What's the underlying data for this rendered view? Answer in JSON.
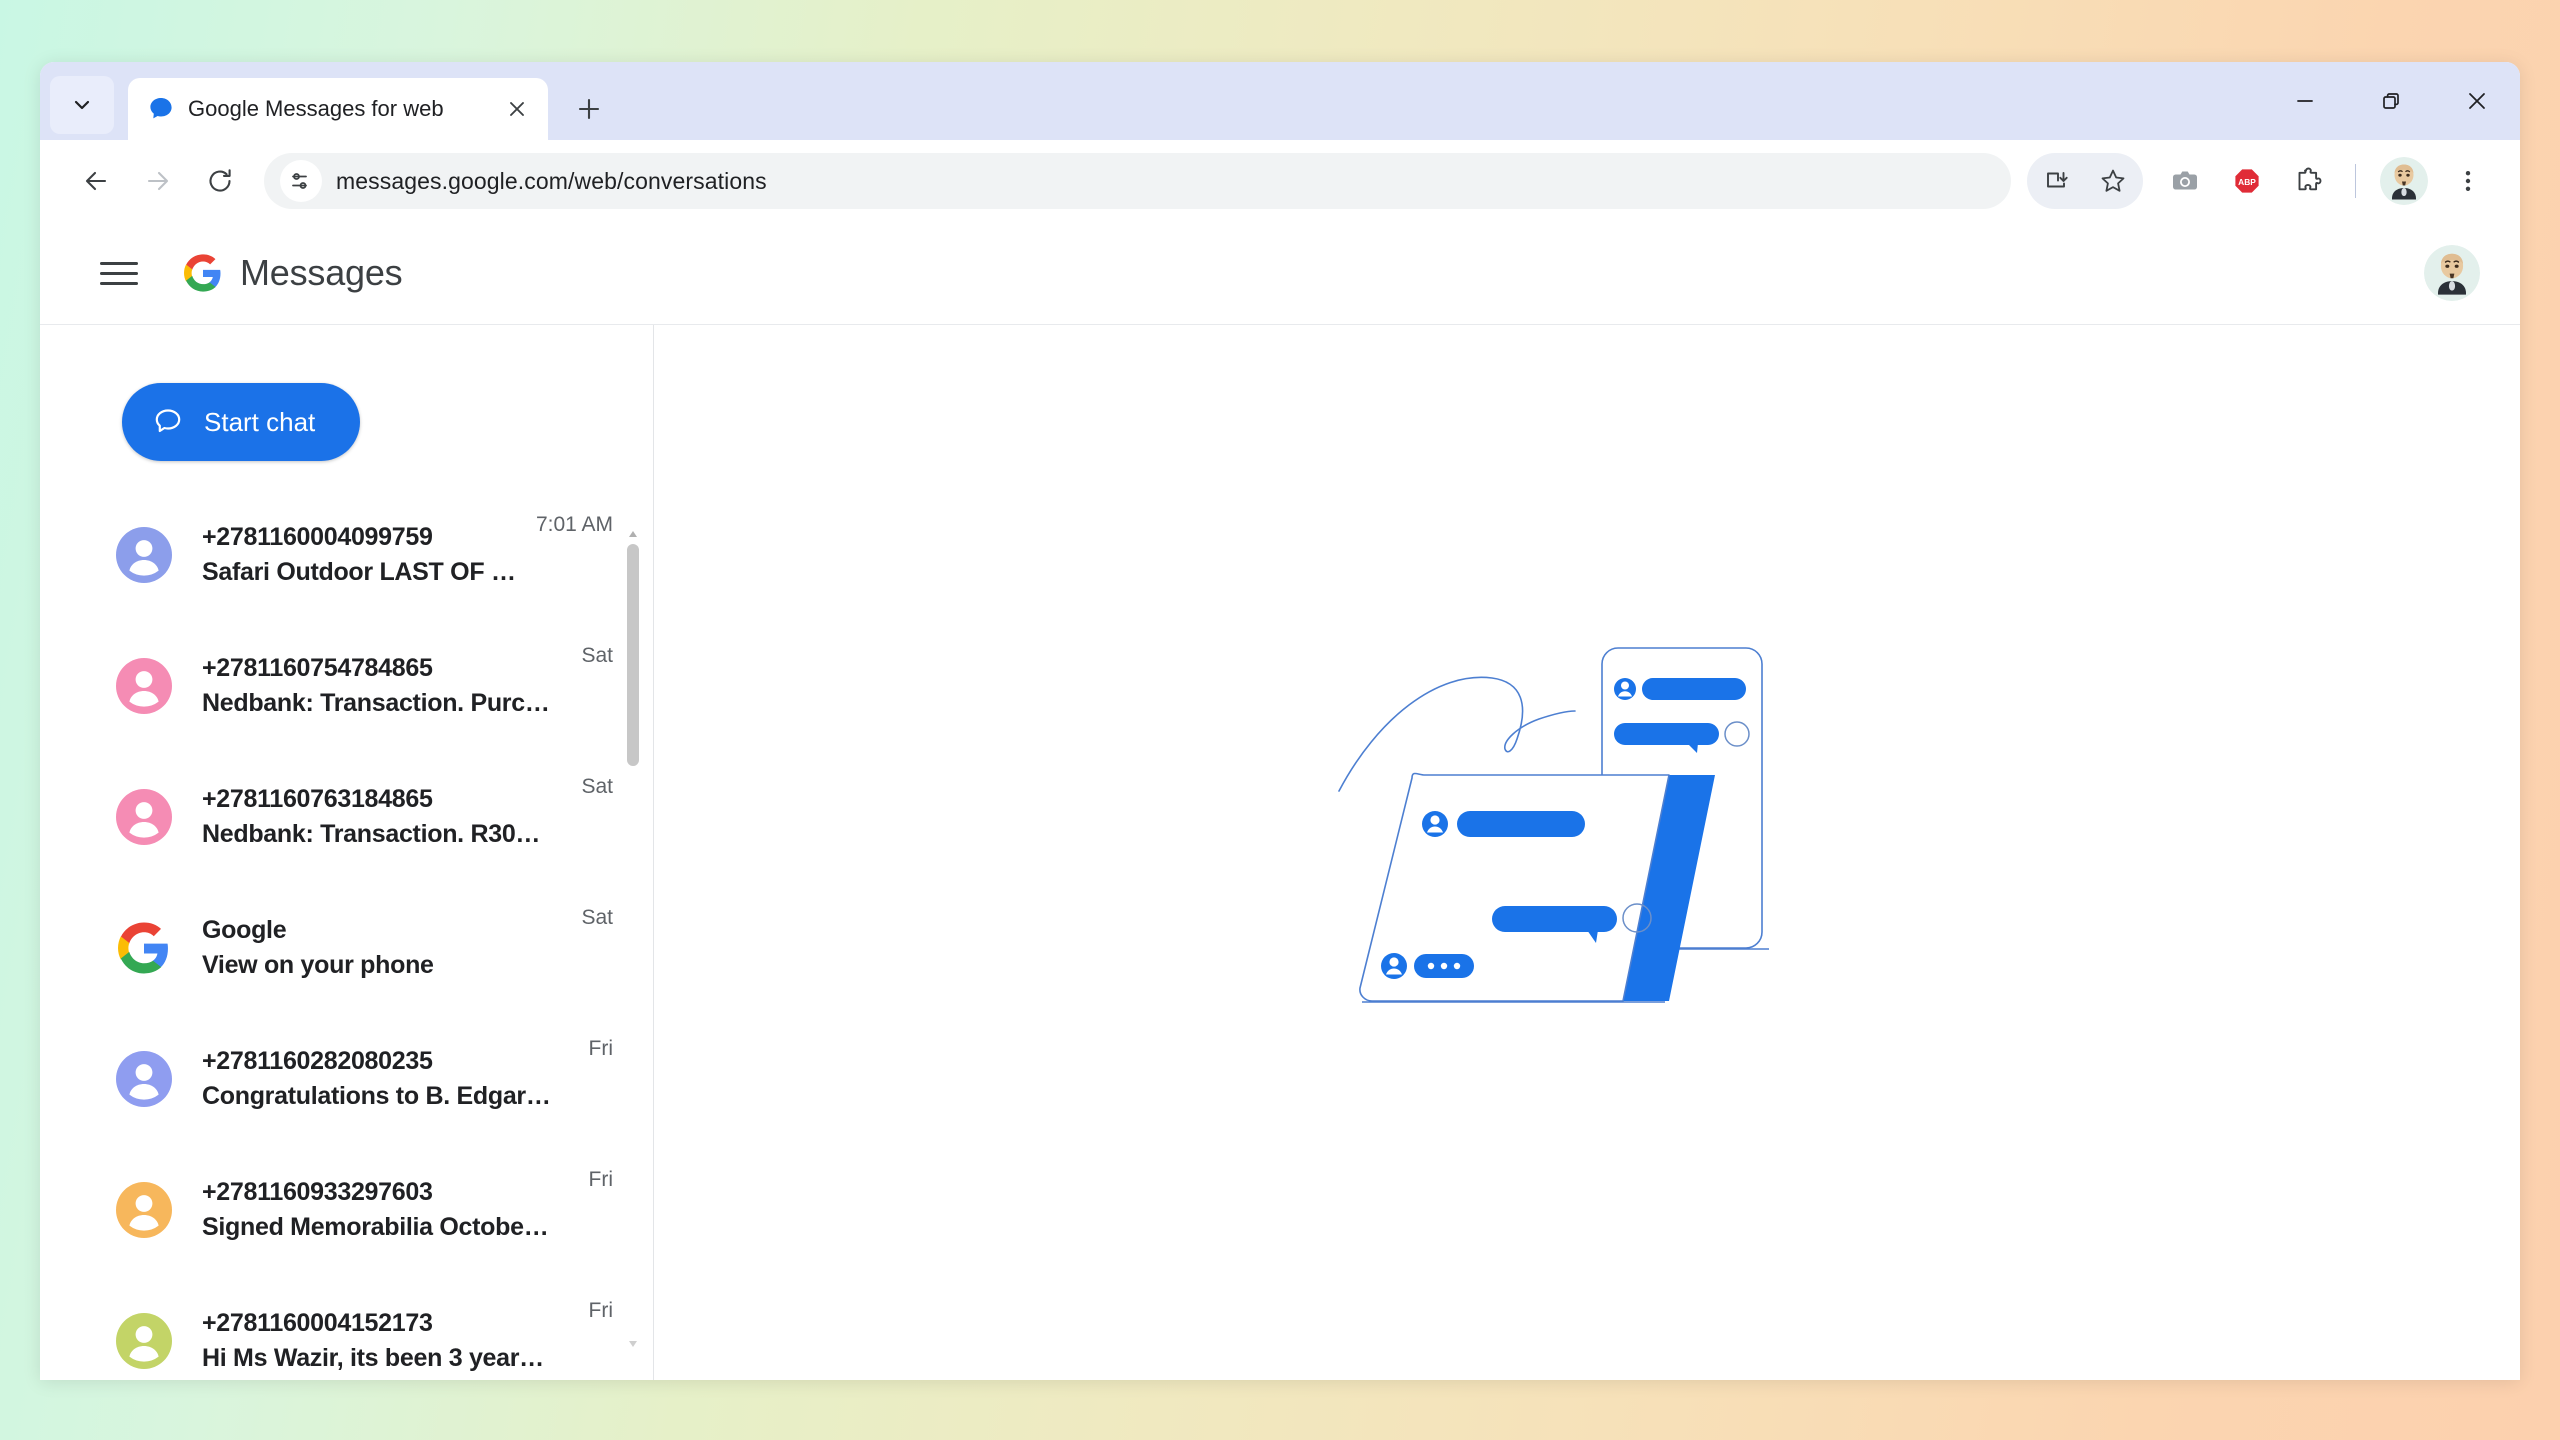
{
  "browser": {
    "tab": {
      "title": "Google Messages for web",
      "favicon_icon": "messages-bubble-icon",
      "close_icon": "close-icon"
    },
    "new_tab_icon": "plus-icon",
    "tab_list_chevron_icon": "chevron-down-icon",
    "window_controls": {
      "minimize_icon": "minimize-icon",
      "maximize_icon": "restore-icon",
      "close_icon": "close-icon"
    },
    "toolbar": {
      "back_icon": "back-arrow-icon",
      "forward_icon": "forward-arrow-icon",
      "reload_icon": "reload-icon",
      "site_settings_icon": "tune-icon",
      "url": "messages.google.com/web/conversations",
      "install_icon": "install-app-icon",
      "bookmark_icon": "star-icon",
      "camera_extension_icon": "camera-icon",
      "adblock_icon": "adblock-plus-icon",
      "adblock_label": "ABP",
      "extensions_icon": "puzzle-piece-icon",
      "profile_icon": "profile-avatar-icon",
      "menu_icon": "three-dot-menu-icon"
    }
  },
  "app": {
    "header": {
      "menu_icon": "hamburger-menu-icon",
      "logo_icon": "google-g-logo",
      "title": "Messages",
      "account_icon": "account-avatar-icon"
    },
    "start_chat": {
      "label": "Start chat",
      "icon": "chat-bubble-icon"
    },
    "conversations": [
      {
        "name": "+27811600040997 59",
        "display_name": "+2781160004099759",
        "snippet": "Safari Outdoor LAST OF …",
        "time": "7:01 AM",
        "avatar_color": "#8c9eeb",
        "avatar_type": "person"
      },
      {
        "display_name": "+2781160754784865",
        "snippet": "Nedbank: Transaction. Purc…",
        "time": "Sat",
        "avatar_color": "#f58cb4",
        "avatar_type": "person"
      },
      {
        "display_name": "+2781160763184865",
        "snippet": "Nedbank: Transaction. R30…",
        "time": "Sat",
        "avatar_color": "#f58cb4",
        "avatar_type": "person"
      },
      {
        "display_name": "Google",
        "snippet": "View on your phone",
        "time": "Sat",
        "avatar_color": "#ffffff",
        "avatar_type": "google-logo"
      },
      {
        "display_name": "+2781160282080235",
        "snippet": "Congratulations to B. Edgar…",
        "time": "Fri",
        "avatar_color": "#8f9df0",
        "avatar_type": "person"
      },
      {
        "display_name": "+2781160933297603",
        "snippet": "Signed Memorabilia Octobe…",
        "time": "Fri",
        "avatar_color": "#f7b75c",
        "avatar_type": "person"
      },
      {
        "display_name": "+2781160004152173",
        "snippet": "Hi Ms Wazir, its been 3 year…",
        "time": "Fri",
        "avatar_color": "#c3d467",
        "avatar_type": "person"
      }
    ],
    "empty_state": {
      "illustration_icon": "chat-panels-illustration"
    },
    "scrollbar": {
      "up_arrow_icon": "scroll-up-arrow-icon",
      "down_arrow_icon": "scroll-down-arrow-icon"
    }
  },
  "colors": {
    "accent_blue": "#1b72e8",
    "illustration_blue": "#1a73e8",
    "tabstrip": "#dde3f7",
    "omnibox": "#f1f3f4"
  }
}
